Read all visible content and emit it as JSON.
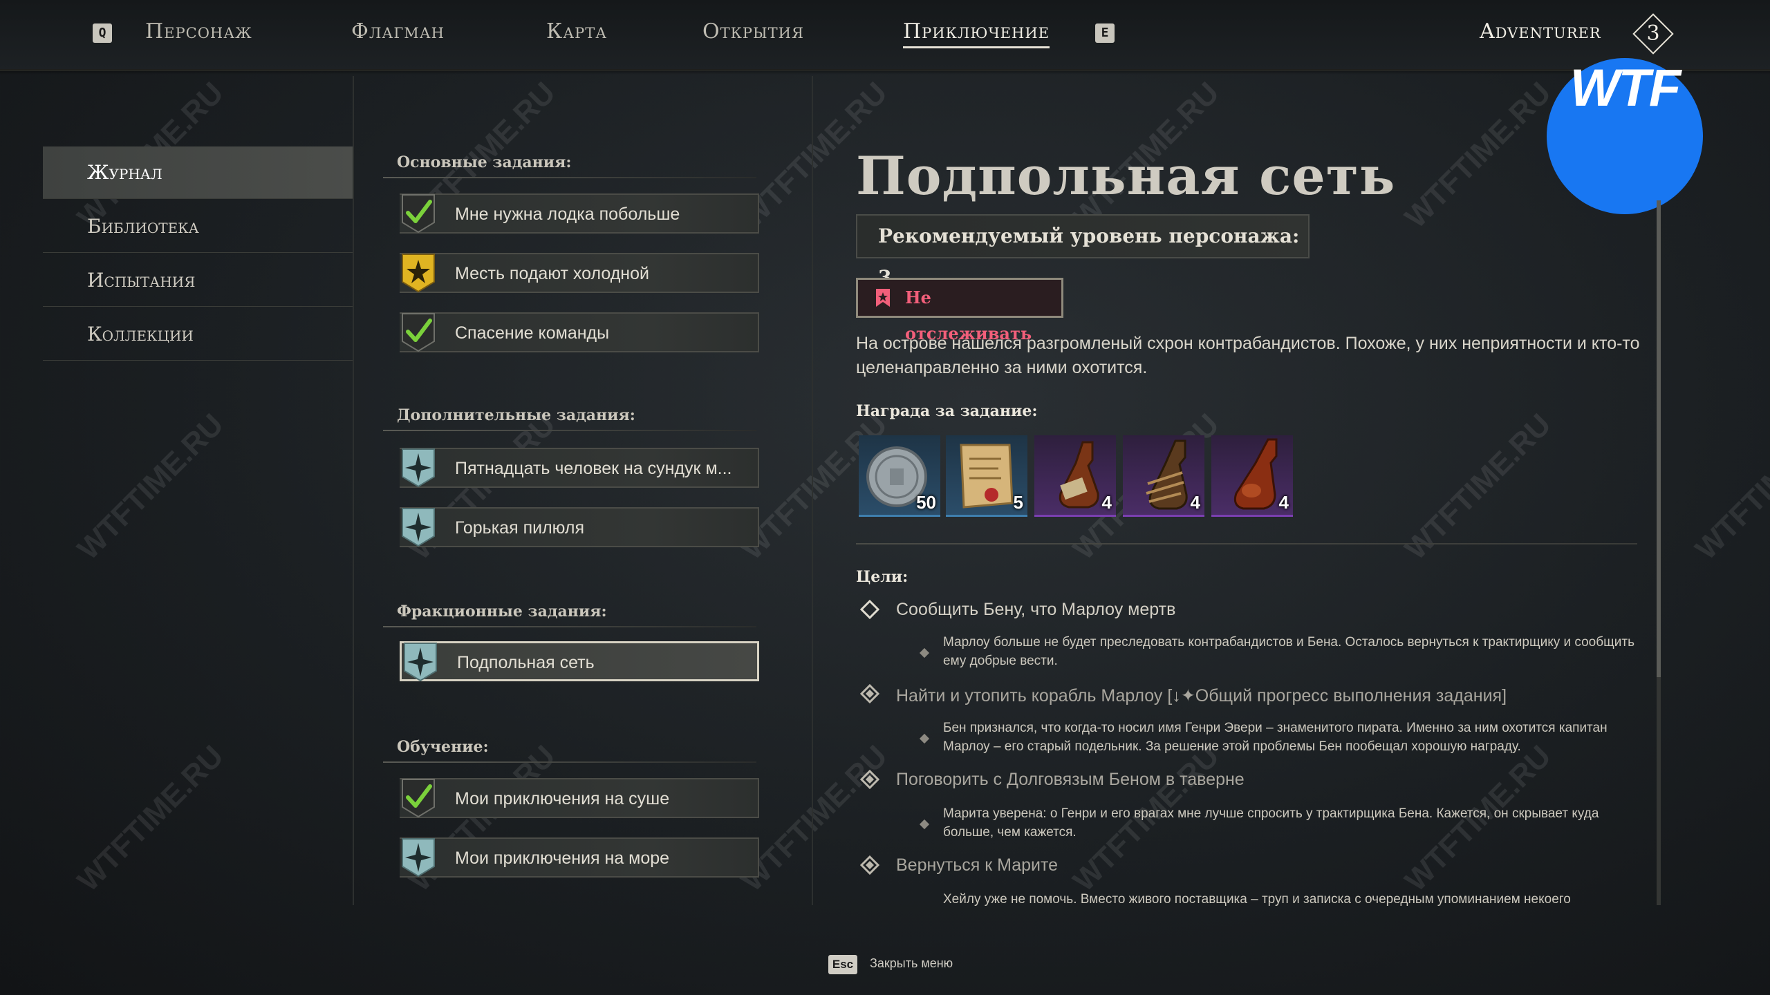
{
  "topnav": {
    "prev_key": "Q",
    "next_key": "E",
    "tabs": [
      {
        "label": "Персонаж"
      },
      {
        "label": "Флагман"
      },
      {
        "label": "Карта"
      },
      {
        "label": "Открытия"
      },
      {
        "label": "Приключение",
        "active": true
      }
    ],
    "player_name": "Adventurer",
    "player_level": "3"
  },
  "sidebar": {
    "items": [
      {
        "label": "Журнал",
        "active": true
      },
      {
        "label": "Библиотека"
      },
      {
        "label": "Испытания"
      },
      {
        "label": "Коллекции"
      }
    ]
  },
  "quests": {
    "main_label": "Основные задания:",
    "main": [
      {
        "label": "Мне нужна лодка побольше",
        "status": "completed"
      },
      {
        "label": "Месть подают холодной",
        "status": "tracked"
      },
      {
        "label": "Спасение команды",
        "status": "completed"
      }
    ],
    "side_label": "Дополнительные задания:",
    "side": [
      {
        "label": "Пятнадцать человек на сундук м...",
        "status": "active"
      },
      {
        "label": "Горькая пилюля",
        "status": "active"
      }
    ],
    "faction_label": "Фракционные задания:",
    "faction": [
      {
        "label": "Подпольная сеть",
        "status": "active",
        "selected": true
      }
    ],
    "tutorial_label": "Обучение:",
    "tutorial": [
      {
        "label": "Мои приключения на суше",
        "status": "completed"
      },
      {
        "label": "Мои приключения на море",
        "status": "active"
      }
    ]
  },
  "detail": {
    "title": "Подпольная сеть",
    "recommended_level": "Рекомендуемый уровень персонажа: 3",
    "untrack_label": "Не отслеживать",
    "description": "На острове нашелся разгромленый схрон контрабандистов. Похоже, у них неприятности и кто-то целенаправленно за ними охотится.",
    "reward_label": "Награда за задание:",
    "rewards": [
      {
        "icon": "silver-coin-icon",
        "count": "50",
        "rarity_color": "#3f7fae"
      },
      {
        "icon": "map-scroll-icon",
        "count": "5",
        "rarity_color": "#3f7fae"
      },
      {
        "icon": "rum-bottle-icon",
        "count": "4",
        "rarity_color": "#7a3fb0"
      },
      {
        "icon": "rope-bottle-icon",
        "count": "4",
        "rarity_color": "#7a3fb0"
      },
      {
        "icon": "brandy-bottle-icon",
        "count": "4",
        "rarity_color": "#7a3fb0"
      }
    ],
    "goals_label": "Цели:",
    "goals": [
      {
        "title": "Сообщить Бену, что Марлоу мертв",
        "note": "Марлоу больше не будет преследовать контрабандистов и Бена. Осталось вернуться к трактирщику и сообщить ему добрые вести.",
        "state": "current"
      },
      {
        "title": "Найти и утопить корабль Марлоу [",
        "progress_tag": "Общий прогресс выполнения задания]",
        "note": "Бен признался, что когда-то носил имя Генри Эвери – знаменитого пирата. Именно за ним охотится капитан Марлоу – его старый подельник. За решение этой проблемы Бен пообещал хорошую награду.",
        "state": "done"
      },
      {
        "title": "Поговорить с Долговязым Беном в таверне",
        "note": "Марита уверена: о Генри и его врагах мне лучше спросить у трактирщика Бена. Кажется, он скрывает куда больше, чем кажется.",
        "state": "done"
      },
      {
        "title": "Вернуться к Марите",
        "note": "Хейлу уже не помочь. Вместо живого поставщика – труп и записка с очередным упоминанием некоего",
        "state": "done"
      }
    ]
  },
  "footer": {
    "key": "Esc",
    "label": "Закрыть меню"
  },
  "watermark": {
    "text": "WTFTIME.RU",
    "logo_text": "WTF"
  }
}
